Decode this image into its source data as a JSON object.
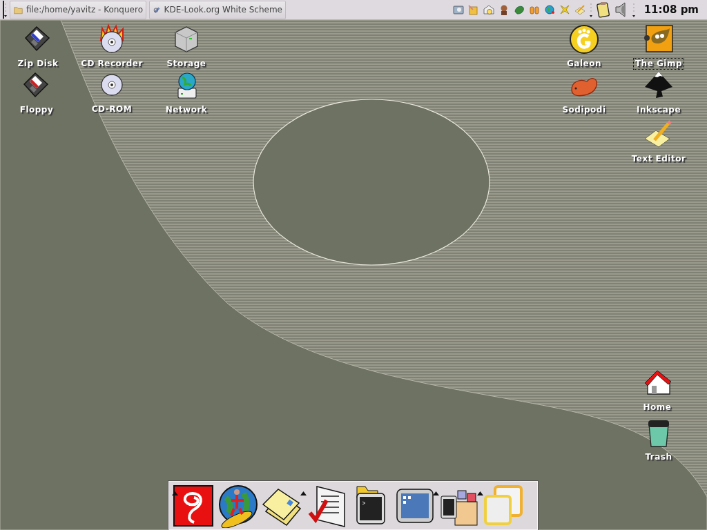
{
  "taskbar": {
    "tasks": [
      {
        "title": "file:/home/yavitz - Konquero"
      },
      {
        "title": "KDE-Look.org White Scheme"
      }
    ],
    "clock": "11:08 pm"
  },
  "desktop_icons": [
    {
      "label": "Zip Disk",
      "selected": false
    },
    {
      "label": "CD Recorder",
      "selected": false
    },
    {
      "label": "Storage",
      "selected": false
    },
    {
      "label": "Galeon",
      "selected": false
    },
    {
      "label": "The Gimp",
      "selected": true
    },
    {
      "label": "Floppy",
      "selected": false
    },
    {
      "label": "CD-ROM",
      "selected": false
    },
    {
      "label": "Network",
      "selected": false
    },
    {
      "label": "Sodipodi",
      "selected": false
    },
    {
      "label": "Inkscape",
      "selected": false
    },
    {
      "label": "Text Editor",
      "selected": false
    },
    {
      "label": "Home",
      "selected": false
    },
    {
      "label": "Trash",
      "selected": false
    }
  ]
}
